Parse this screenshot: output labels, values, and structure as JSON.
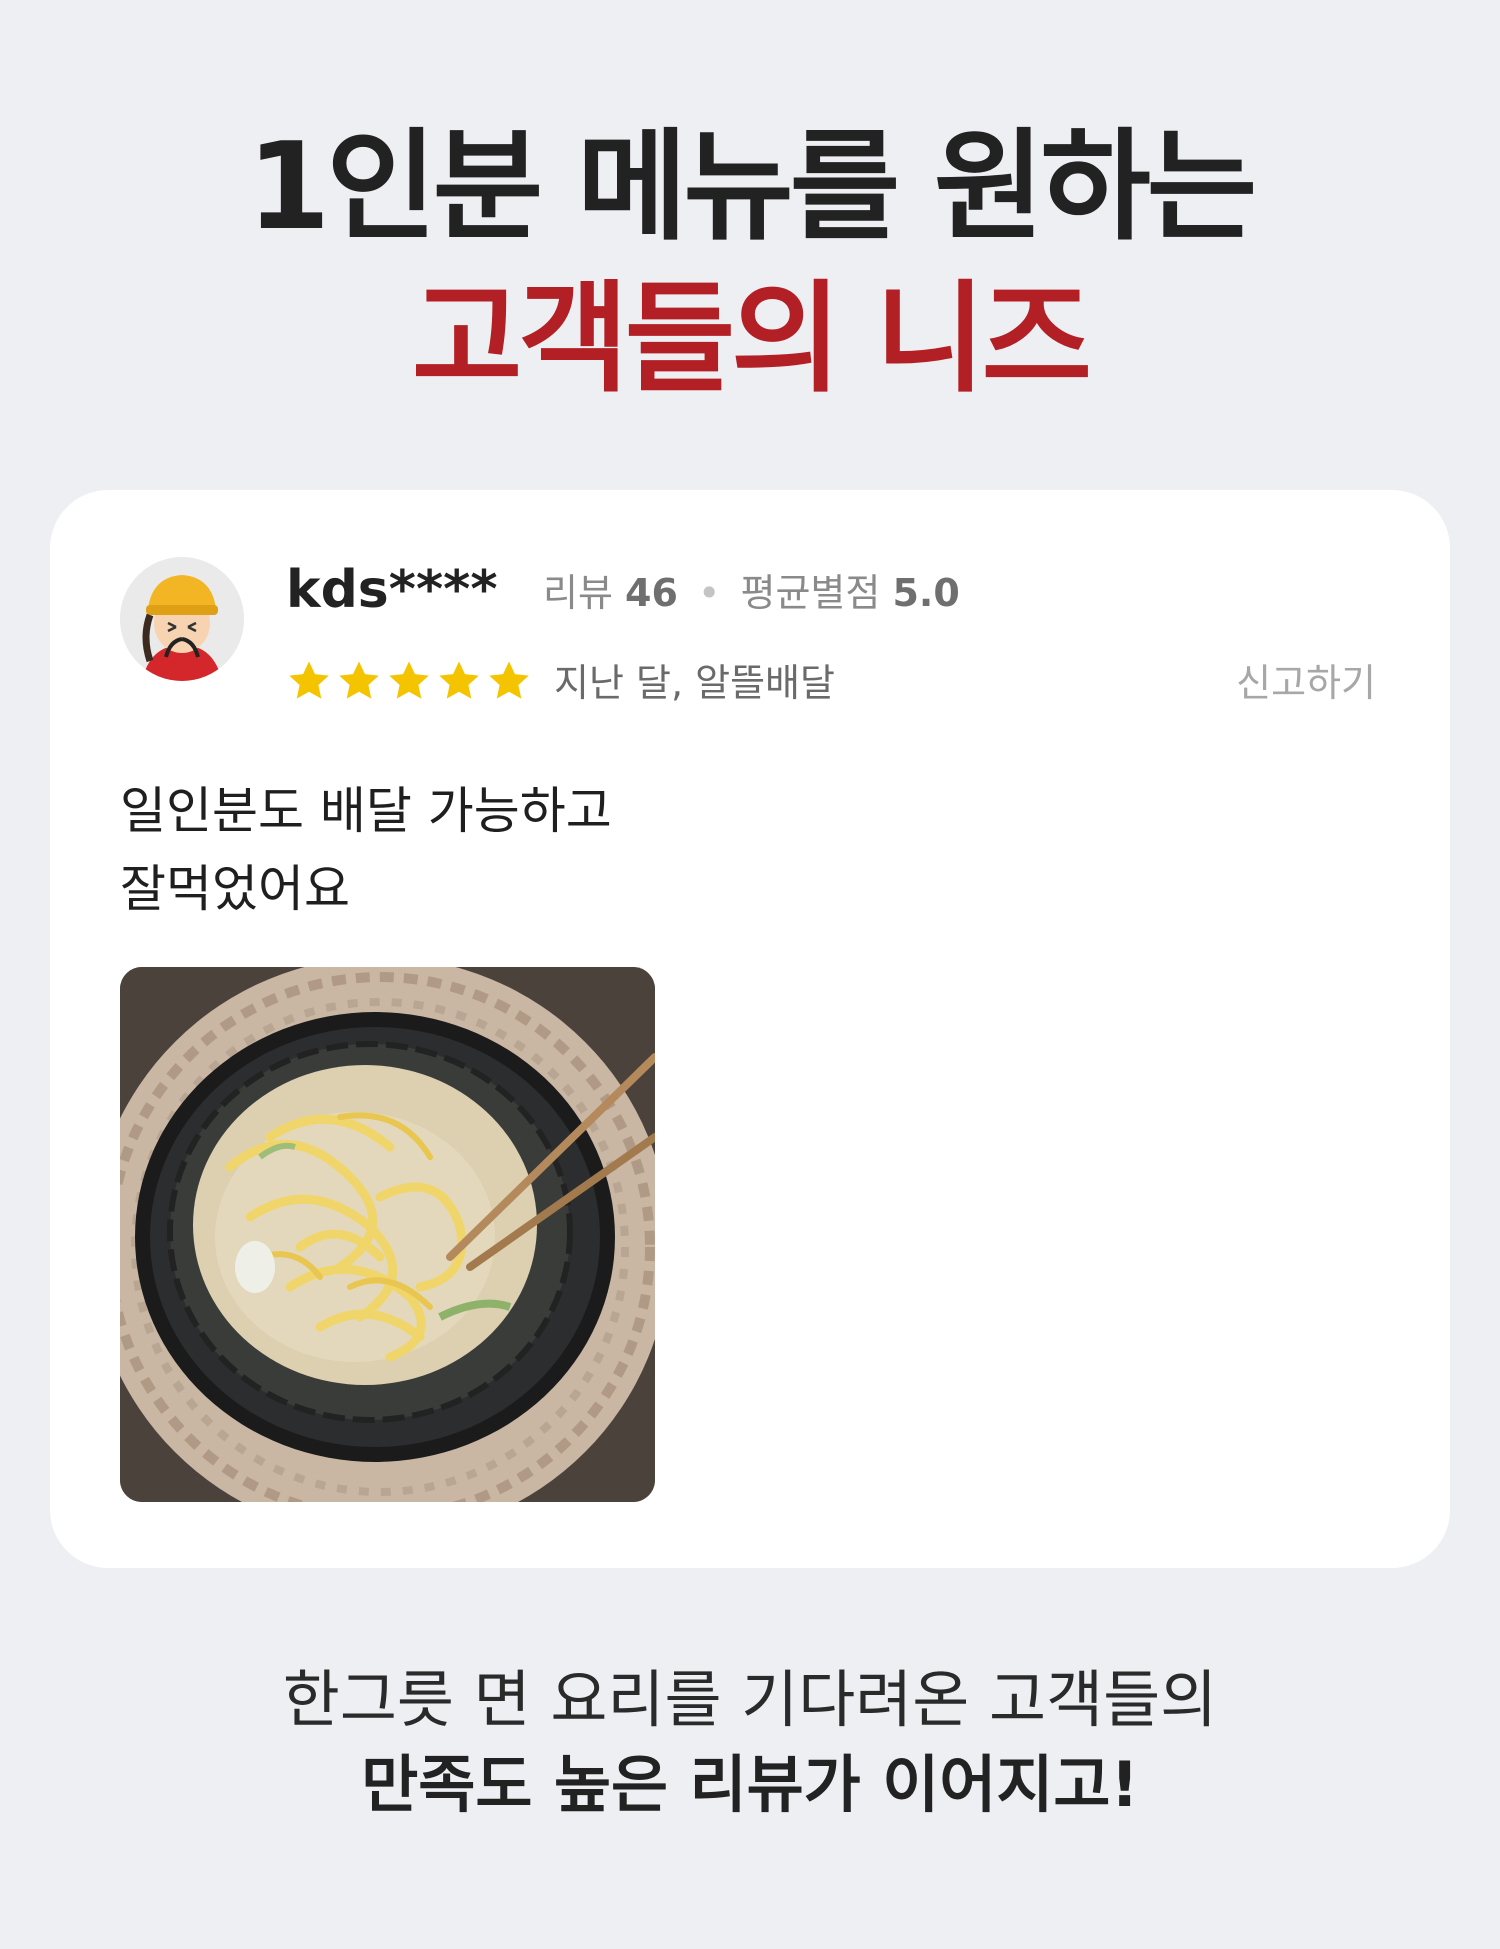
{
  "headline": {
    "line1": "1인분 메뉴를 원하는",
    "line2": "고객들의 니즈"
  },
  "review": {
    "username": "kds****",
    "review_label": "리뷰",
    "review_count": "46",
    "separator": "•",
    "avg_label": "평균별점",
    "avg_rating": "5.0",
    "rating": 5,
    "rating_max": 5,
    "date_source": "지난 달, 알뜰배달",
    "report_label": "신고하기",
    "text_lines": [
      "일인분도 배달 가능하고",
      "잘먹었어요"
    ],
    "photo_icon": "noodle-bowl-photo"
  },
  "footer": {
    "line1": "한그릇 면 요리를 기다려온 고객들의",
    "line2": "만족도 높은 리뷰가 이어지고!"
  },
  "colors": {
    "background": "#eeeff3",
    "accent_red": "#b21f24",
    "star_yellow": "#f5c400",
    "card": "#ffffff"
  }
}
